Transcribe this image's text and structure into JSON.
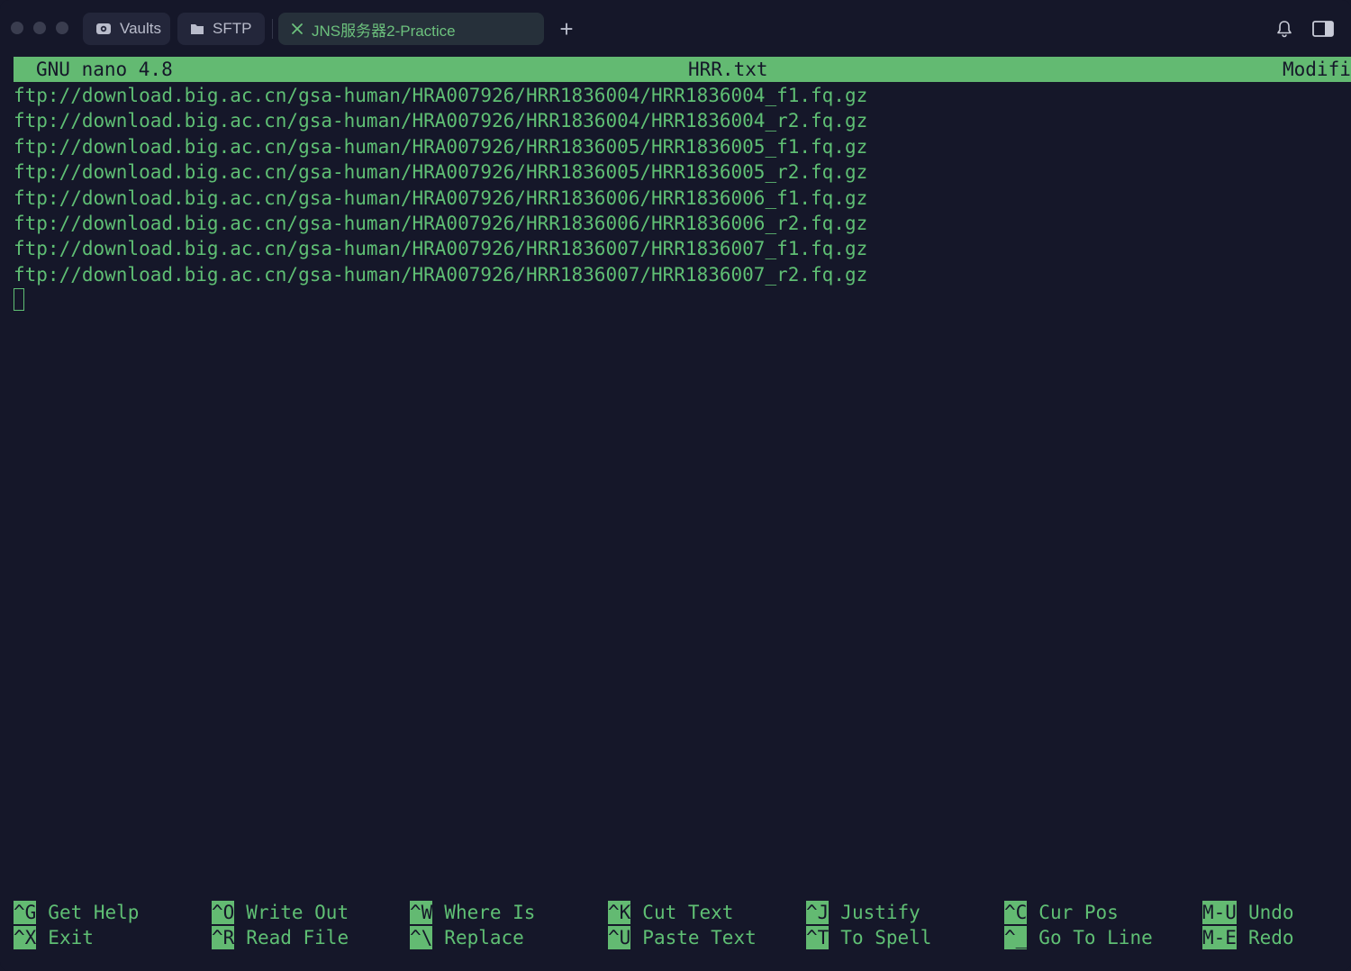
{
  "titlebar": {
    "tabs": [
      {
        "label": "Vaults",
        "icon": "vault-icon"
      },
      {
        "label": "SFTP",
        "icon": "folder-icon"
      },
      {
        "label": "JNS服务器2-Practice",
        "icon": "close-icon",
        "active": true
      }
    ],
    "new_tab_label": "+"
  },
  "nano": {
    "app": "GNU nano 4.8",
    "filename": "HRR.txt",
    "status": "Modifi"
  },
  "lines": [
    "ftp://download.big.ac.cn/gsa-human/HRA007926/HRR1836004/HRR1836004_f1.fq.gz",
    "ftp://download.big.ac.cn/gsa-human/HRA007926/HRR1836004/HRR1836004_r2.fq.gz",
    "ftp://download.big.ac.cn/gsa-human/HRA007926/HRR1836005/HRR1836005_f1.fq.gz",
    "ftp://download.big.ac.cn/gsa-human/HRA007926/HRR1836005/HRR1836005_r2.fq.gz",
    "ftp://download.big.ac.cn/gsa-human/HRA007926/HRR1836006/HRR1836006_f1.fq.gz",
    "ftp://download.big.ac.cn/gsa-human/HRA007926/HRR1836006/HRR1836006_r2.fq.gz",
    "ftp://download.big.ac.cn/gsa-human/HRA007926/HRR1836007/HRR1836007_f1.fq.gz",
    "ftp://download.big.ac.cn/gsa-human/HRA007926/HRR1836007/HRR1836007_r2.fq.gz"
  ],
  "shortcuts": [
    [
      {
        "key": "^G",
        "label": "Get Help"
      },
      {
        "key": "^X",
        "label": "Exit"
      }
    ],
    [
      {
        "key": "^O",
        "label": "Write Out"
      },
      {
        "key": "^R",
        "label": "Read File"
      }
    ],
    [
      {
        "key": "^W",
        "label": "Where Is"
      },
      {
        "key": "^\\",
        "label": "Replace"
      }
    ],
    [
      {
        "key": "^K",
        "label": "Cut Text"
      },
      {
        "key": "^U",
        "label": "Paste Text"
      }
    ],
    [
      {
        "key": "^J",
        "label": "Justify"
      },
      {
        "key": "^T",
        "label": "To Spell"
      }
    ],
    [
      {
        "key": "^C",
        "label": "Cur Pos"
      },
      {
        "key": "^_",
        "label": "Go To Line"
      }
    ],
    [
      {
        "key": "M-U",
        "label": "Undo"
      },
      {
        "key": "M-E",
        "label": "Redo"
      }
    ]
  ],
  "colors": {
    "background": "#151729",
    "accent_green": "#63ba72",
    "text_green": "#5fbf74"
  }
}
